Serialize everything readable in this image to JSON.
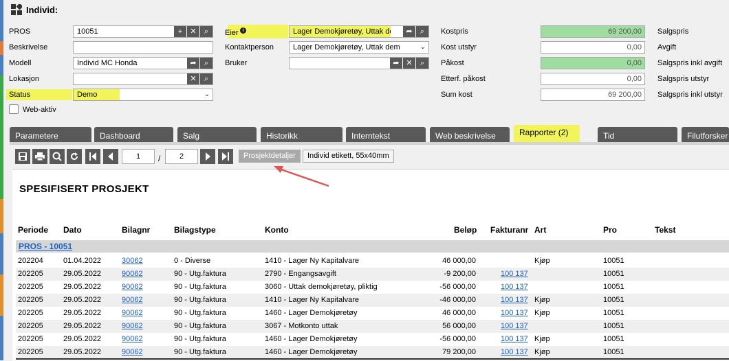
{
  "window": {
    "title": "Individ:"
  },
  "form": {
    "left": {
      "pros_label": "PROS",
      "pros_value": "10051",
      "beskrivelse_label": "Beskrivelse",
      "beskrivelse_value": "",
      "modell_label": "Modell",
      "modell_value": "Individ MC Honda",
      "lokasjon_label": "Lokasjon",
      "lokasjon_value": "",
      "status_label": "Status",
      "status_value": "Demo",
      "webaktiv_label": "Web-aktiv"
    },
    "middle": {
      "eier_label": "Eier",
      "eier_value": "Lager Demokjøretøy, Uttak dem",
      "kontakt_label": "Kontaktperson",
      "kontakt_value": "Lager Demokjøretøy, Uttak dem",
      "bruker_label": "Bruker",
      "bruker_value": ""
    },
    "costs": {
      "kostpris_label": "Kostpris",
      "kostpris_value": "69 200,00",
      "kostutstyr_label": "Kost utstyr",
      "kostutstyr_value": "0,00",
      "pakost_label": "Påkost",
      "pakost_value": "0,00",
      "etterf_label": "Etterf. påkost",
      "etterf_value": "0,00",
      "sumkost_label": "Sum kost",
      "sumkost_value": "69 200,00"
    },
    "right_labels": [
      "Salgspris",
      "Avgift",
      "Salgspris inkl avgift",
      "Salgspris utstyr",
      "Salgspris inkl utstyr"
    ]
  },
  "tabs": [
    "Parametere",
    "Dashboard",
    "Salg",
    "Historikk",
    "Interntekst",
    "Web beskrivelse",
    "Rapporter (2)",
    "Tid",
    "Filutforsker"
  ],
  "toolbar": {
    "page_current": "1",
    "page_sep": "/",
    "page_total": "2",
    "report1": "Prosjektdetaljer",
    "report2": "Individ etikett, 55x40mm"
  },
  "report": {
    "title": "SPESIFISERT PROSJEKT",
    "columns": [
      "Periode",
      "Dato",
      "Bilagnr",
      "Bilagstype",
      "Konto",
      "Beløp",
      "Fakturanr",
      "Art",
      "Pro",
      "Tekst"
    ],
    "group": "PROS - 10051",
    "rows": [
      [
        "202204",
        "01.04.2022",
        "30062",
        "0 - Diverse",
        "1410 - Lager Ny Kapitalvare",
        "46 000,00",
        "",
        "Kjøp",
        "10051"
      ],
      [
        "202205",
        "29.05.2022",
        "90062",
        "90 - Utg.faktura",
        "2790 - Engangsavgift",
        "-9 200,00",
        "100 137",
        "",
        "10051"
      ],
      [
        "202205",
        "29.05.2022",
        "90062",
        "90 - Utg.faktura",
        "3060 - Uttak demokjøretøy, pliktig",
        "-56 000,00",
        "100 137",
        "",
        "10051"
      ],
      [
        "202205",
        "29.05.2022",
        "90062",
        "90 - Utg.faktura",
        "1410 - Lager Ny Kapitalvare",
        "-46 000,00",
        "100 137",
        "Kjøp",
        "10051"
      ],
      [
        "202205",
        "29.05.2022",
        "90062",
        "90 - Utg.faktura",
        "1460 - Lager Demokjøretøy",
        "46 000,00",
        "100 137",
        "Kjøp",
        "10051"
      ],
      [
        "202205",
        "29.05.2022",
        "90062",
        "90 - Utg.faktura",
        "3067 - Motkonto uttak",
        "56 000,00",
        "100 137",
        "",
        "10051"
      ],
      [
        "202205",
        "29.05.2022",
        "90062",
        "90 - Utg.faktura",
        "1460 - Lager Demokjøretøy",
        "-56 000,00",
        "100 137",
        "Kjøp",
        "10051"
      ],
      [
        "202205",
        "29.05.2022",
        "90062",
        "90 - Utg.faktura",
        "1460 - Lager Demokjøretøy",
        "79 200,00",
        "100 137",
        "Kjøp",
        "10051"
      ]
    ]
  },
  "colors": {
    "highlight": "#f1f55a",
    "green_field": "#9fdc9f",
    "dark_button": "#595959",
    "link": "#1f5fbf",
    "annotation_arrow": "#e05555"
  }
}
